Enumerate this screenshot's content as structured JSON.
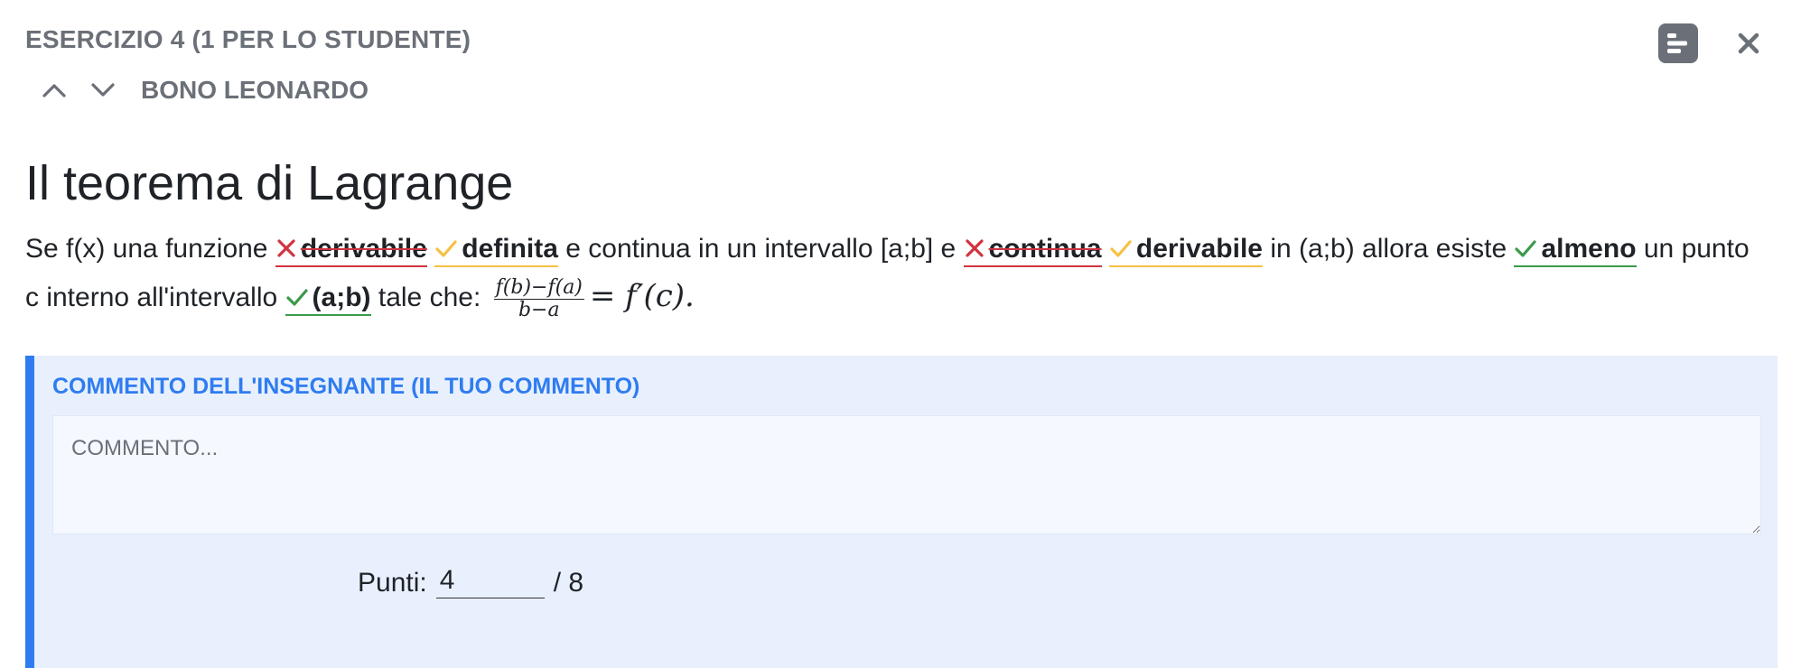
{
  "header": {
    "exercise_label": "ESERCIZIO 4 (1 PER LO STUDENTE)",
    "student_name": "BONO LEONARDO"
  },
  "colors": {
    "wrong": "#d0343f",
    "partial": "#f5c142",
    "correct": "#3a9a4a",
    "accent": "#2f7cf0",
    "comment_bg": "#e8f0fe"
  },
  "icons": {
    "prev": "chevron-up-icon",
    "next": "chevron-down-icon",
    "summary": "summary-icon",
    "close": "close-icon"
  },
  "exercise": {
    "title": "Il teorema di Lagrange",
    "seg1": "Se f(x) una funzione",
    "answer1_given": "derivabile",
    "answer1_expected": "definita",
    "seg2": "e continua in un intervallo [a;b] e",
    "answer2_given": "continua",
    "answer2_expected": "derivabile",
    "seg3": "in (a;b) allora esiste",
    "answer3": "almeno",
    "seg4": "un punto c interno all'intervallo",
    "answer4": "(a;b)",
    "seg5": "tale che:",
    "formula": {
      "numerator": "f(b)−f(a)",
      "denominator": "b−a",
      "rhs": "= f′(c)."
    }
  },
  "comment": {
    "label": "COMMENTO DELL'INSEGNANTE (IL TUO COMMENTO)",
    "placeholder": "COMMENTO..."
  },
  "points": {
    "label": "Punti:",
    "value": "4",
    "max": "/ 8"
  }
}
